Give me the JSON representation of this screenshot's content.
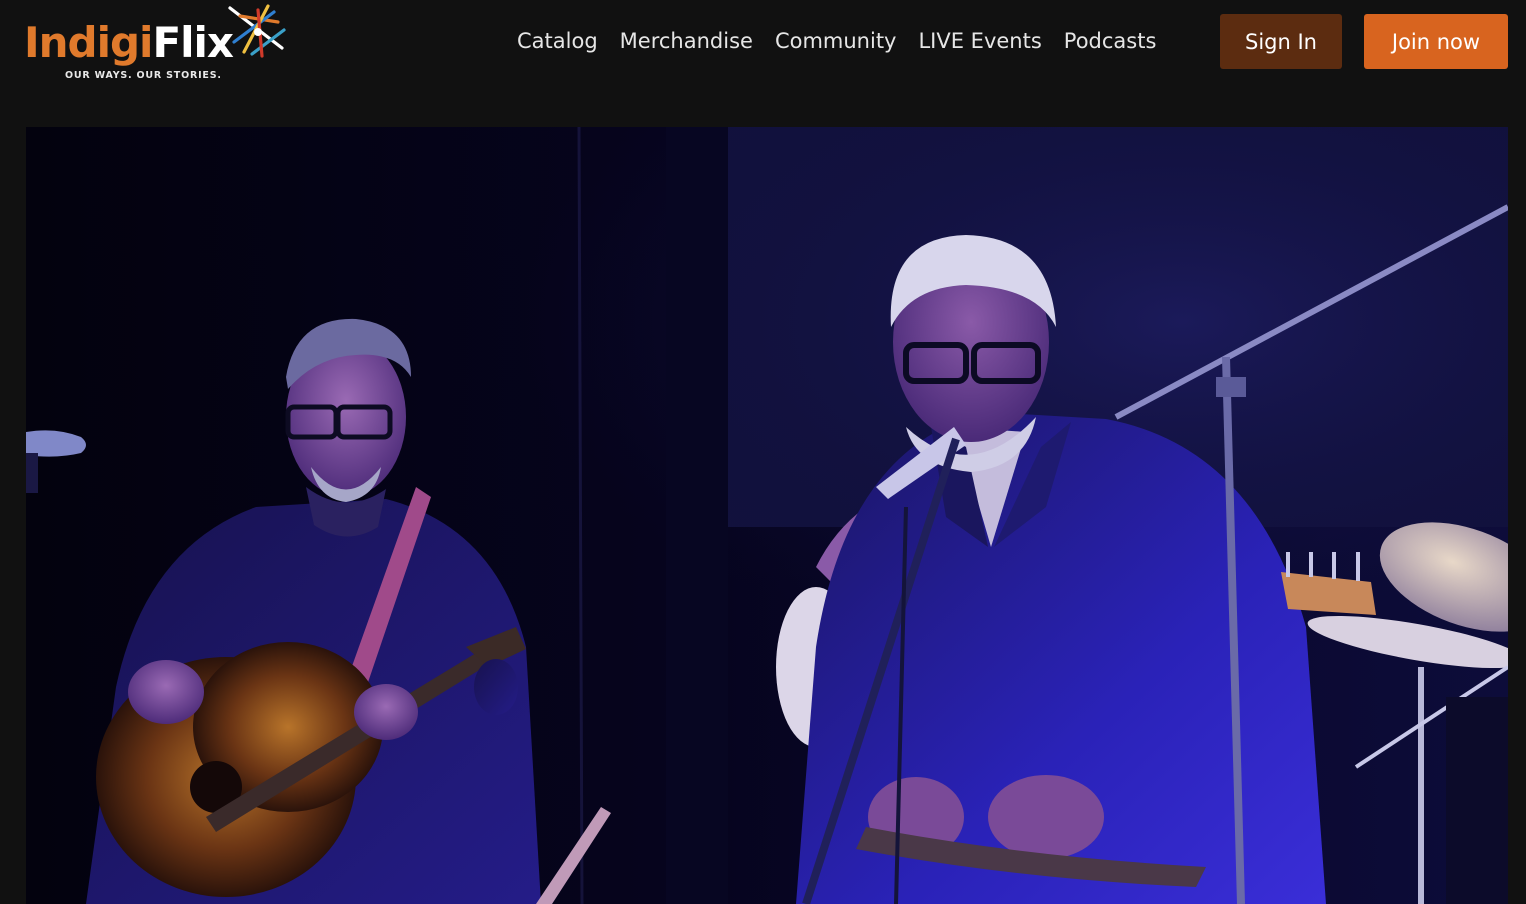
{
  "brand": {
    "name_part1": "Indigi",
    "name_part2": "Flix",
    "tagline": "OUR WAYS. OUR STORIES."
  },
  "nav": {
    "items": [
      {
        "label": "Catalog"
      },
      {
        "label": "Merchandise"
      },
      {
        "label": "Community"
      },
      {
        "label": "LIVE Events"
      },
      {
        "label": "Podcasts"
      }
    ]
  },
  "auth": {
    "sign_in_label": "Sign In",
    "join_label": "Join now"
  },
  "colors": {
    "background": "#111111",
    "brand_orange": "#d8641f",
    "sign_in_bg": "#5c2c10",
    "logo_orange": "#e07a2c"
  },
  "hero": {
    "icon": "concert-photo"
  }
}
